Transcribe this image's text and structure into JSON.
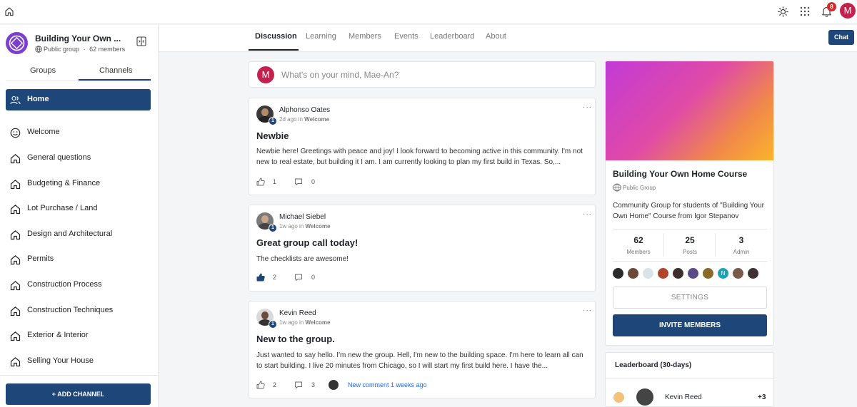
{
  "topbar": {
    "notification_count": "8",
    "user_initial": "M"
  },
  "group": {
    "title": "Building Your Own ...",
    "privacy": "Public group",
    "separator": "·",
    "members": "62 members"
  },
  "sidebar": {
    "tabs": [
      "Groups",
      "Channels"
    ],
    "active_tab": "Channels",
    "items": [
      {
        "label": "Home",
        "icon": "people-icon",
        "active": true
      },
      {
        "label": "Welcome",
        "icon": "smile-icon"
      },
      {
        "label": "General questions",
        "icon": "home-icon"
      },
      {
        "label": "Budgeting & Finance",
        "icon": "home-icon"
      },
      {
        "label": "Lot Purchase / Land",
        "icon": "home-icon"
      },
      {
        "label": "Design and Architectural",
        "icon": "home-icon"
      },
      {
        "label": "Permits",
        "icon": "home-icon"
      },
      {
        "label": "Construction Process",
        "icon": "home-icon"
      },
      {
        "label": "Construction Techniques",
        "icon": "home-icon"
      },
      {
        "label": "Exterior & Interior",
        "icon": "home-icon"
      },
      {
        "label": "Selling Your House",
        "icon": "home-icon"
      }
    ],
    "add_channel": "+ ADD CHANNEL"
  },
  "main_tabs": [
    "Discussion",
    "Learning",
    "Members",
    "Events",
    "Leaderboard",
    "About"
  ],
  "active_main_tab": "Discussion",
  "chat_label": "Chat",
  "composer": {
    "avatar_initial": "M",
    "placeholder": "What's on your mind, Mae-An?"
  },
  "posts": [
    {
      "author": "Alphonso Oates",
      "time": "2d ago",
      "in_label": "in",
      "channel": "Welcome",
      "level": "1",
      "title": "Newbie",
      "body": "Newbie here! Greetings with peace and joy! I look forward to becoming active in this community. I'm not new to real estate, but building it I am. I am currently looking to plan my first build in Texas. So,...",
      "likes": "1",
      "comments": "0",
      "liked": false
    },
    {
      "author": "Michael Siebel",
      "time": "1w ago",
      "in_label": "in",
      "channel": "Welcome",
      "level": "1",
      "title": "Great group call today!",
      "body": "The checklists are awesome!",
      "likes": "2",
      "comments": "0",
      "liked": true
    },
    {
      "author": "Kevin Reed",
      "time": "1w ago",
      "in_label": "in",
      "channel": "Welcome",
      "level": "1",
      "title": "New to the group.",
      "body": "Just wanted to say hello. I'm new the group. Hell, I'm new to the building space. I'm here to learn all can to start building. I live 20 minutes from Chicago, so I will start my first build here. I have the...",
      "likes": "2",
      "comments": "3",
      "liked": false,
      "new_comment": "New comment 1 weeks ago"
    }
  ],
  "right_panel": {
    "title": "Building Your Own Home Course",
    "privacy": "Public Group",
    "description": "Community Group for students of \"Building Your Own Home\" Course from Igor Stepanov",
    "stats": [
      {
        "value": "62",
        "label": "Members"
      },
      {
        "value": "25",
        "label": "Posts"
      },
      {
        "value": "3",
        "label": "Admin"
      }
    ],
    "member_avatar_colors": [
      "#2b2b2b",
      "#6b4a3a",
      "#d8e4ea",
      "#b0452c",
      "#3a3030",
      "#5a4a8a",
      "#8a6a2a",
      "#1aa3b5",
      "#7a5a4a",
      "#3e3232"
    ],
    "member_avatar_letters": [
      "",
      "",
      "",
      "",
      "",
      "",
      "",
      "N",
      "",
      ""
    ],
    "settings": "SETTINGS",
    "invite": "INVITE MEMBERS"
  },
  "leaderboard": {
    "title": "Leaderboard (30-days)",
    "entries": [
      {
        "name": "Kevin Reed",
        "score": "+3"
      }
    ]
  },
  "colors": {
    "primary": "#1e4678",
    "badge": "#d12b2b",
    "avatar": "#c4214f",
    "link": "#2b6acf"
  }
}
